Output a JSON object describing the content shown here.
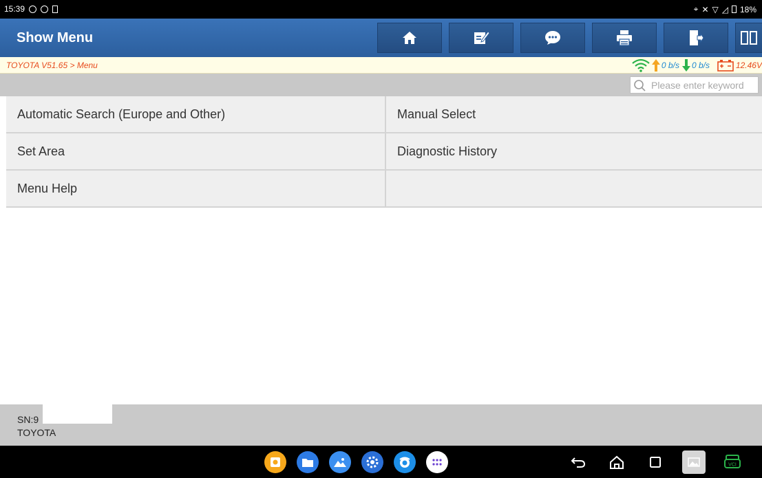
{
  "statusbar": {
    "time": "15:39",
    "battery": "18%"
  },
  "header": {
    "title": "Show Menu",
    "buttons": [
      {
        "name": "home",
        "icon": "home-icon"
      },
      {
        "name": "edit",
        "icon": "edit-icon"
      },
      {
        "name": "message",
        "icon": "chat-icon"
      },
      {
        "name": "print",
        "icon": "print-icon"
      },
      {
        "name": "exit",
        "icon": "exit-icon"
      },
      {
        "name": "split",
        "icon": "split-view-icon"
      }
    ]
  },
  "breadcrumb": {
    "text": "TOYOTA V51.65 > Menu"
  },
  "network": {
    "upload": "0 b/s",
    "download": "0 b/s",
    "voltage": "12.46V"
  },
  "search": {
    "placeholder": "Please enter keyword",
    "value": ""
  },
  "menu": {
    "rows": [
      {
        "left": "Automatic Search (Europe and Other)",
        "right": "Manual Select"
      },
      {
        "left": "Set Area",
        "right": "Diagnostic History"
      },
      {
        "left": "Menu Help",
        "right": ""
      }
    ]
  },
  "footer": {
    "sn_label": "SN:9",
    "vehicle": "TOYOTA"
  },
  "colors": {
    "header": "#2c5f9e",
    "crumb_text": "#e74a1c",
    "wifi": "#2bb34a",
    "upload_arrow": "#f5a623",
    "download_arrow": "#2bb34a"
  }
}
